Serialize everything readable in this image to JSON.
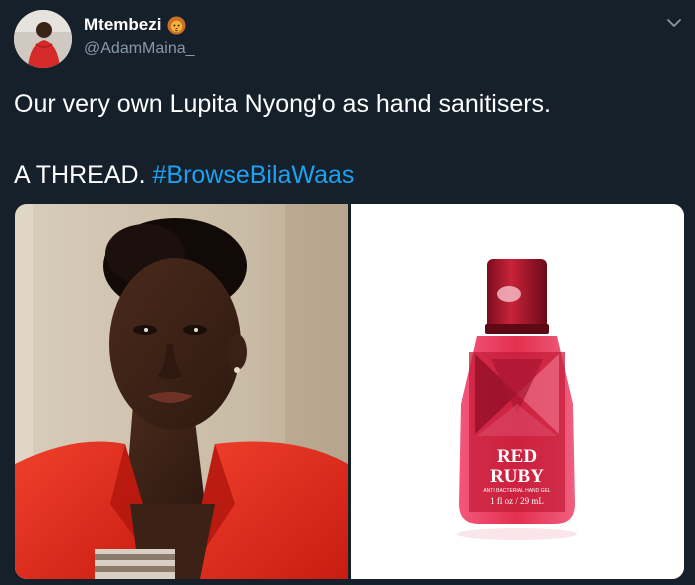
{
  "user": {
    "display_name": "Mtembezi",
    "name_emoji": "lion-face-icon",
    "handle": "@AdamMaina_"
  },
  "tweet": {
    "line1": "Our very own Lupita Nyong'o as hand sanitisers.",
    "line2_text": "A THREAD.",
    "hashtag": "#BrowseBilaWaas"
  },
  "media": {
    "left_image": "photo of woman in red blazer",
    "right_image": "red hand sanitiser bottle",
    "bottle_label": {
      "brand_line1": "RED",
      "brand_line2": "RUBY",
      "small_text": "ANTI BACTERIAL HAND GEL",
      "volume": "1 fl oz / 29 mL"
    }
  },
  "colors": {
    "background": "#15202b",
    "text": "#ffffff",
    "secondary_text": "#8899a6",
    "link": "#1da1f2",
    "blazer_red": "#e0281c",
    "bottle_red": "#e0304a"
  }
}
